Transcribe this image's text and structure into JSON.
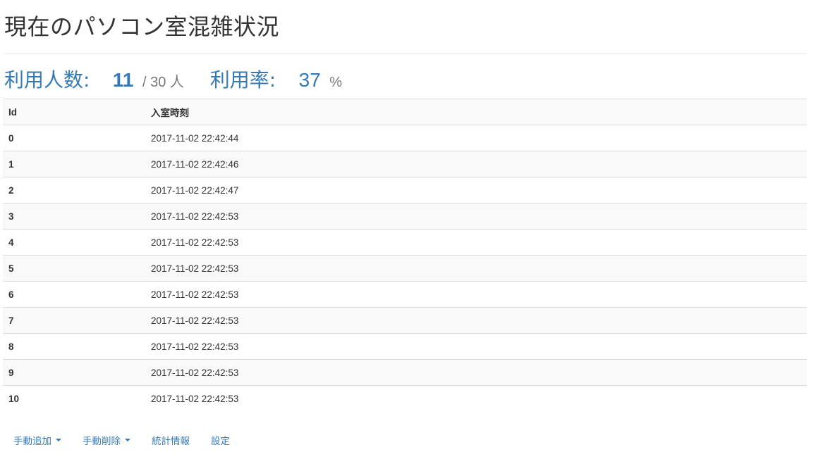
{
  "page": {
    "title": "現在のパソコン室混雑状況"
  },
  "stats": {
    "users_label": "利用人数:",
    "users_count": "11",
    "capacity": "/ 30 人",
    "rate_label": "利用率:",
    "rate_value": "37",
    "rate_unit": "%"
  },
  "table": {
    "headers": [
      "Id",
      "入室時刻"
    ],
    "rows": [
      {
        "id": "0",
        "time": "2017-11-02 22:42:44"
      },
      {
        "id": "1",
        "time": "2017-11-02 22:42:46"
      },
      {
        "id": "2",
        "time": "2017-11-02 22:42:47"
      },
      {
        "id": "3",
        "time": "2017-11-02 22:42:53"
      },
      {
        "id": "4",
        "time": "2017-11-02 22:42:53"
      },
      {
        "id": "5",
        "time": "2017-11-02 22:42:53"
      },
      {
        "id": "6",
        "time": "2017-11-02 22:42:53"
      },
      {
        "id": "7",
        "time": "2017-11-02 22:42:53"
      },
      {
        "id": "8",
        "time": "2017-11-02 22:42:53"
      },
      {
        "id": "9",
        "time": "2017-11-02 22:42:53"
      },
      {
        "id": "10",
        "time": "2017-11-02 22:42:53"
      }
    ]
  },
  "nav": {
    "manual_add": "手動追加",
    "manual_delete": "手動削除",
    "statistics": "統計情報",
    "settings": "設定",
    "dropdown_icon": "caret-down-icon"
  },
  "colors": {
    "accent": "#337ab7",
    "muted": "#777777",
    "stripe": "#f9f9f9",
    "border": "#dddddd"
  }
}
